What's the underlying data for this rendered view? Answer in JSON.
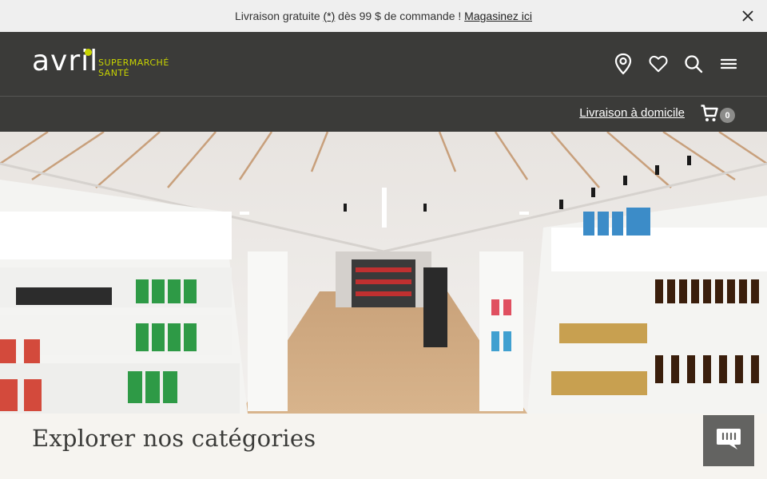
{
  "promo": {
    "text_before": "Livraison gratuite ",
    "asterisk_link": "(*)",
    "text_after": " dès 99 $ de commande ! ",
    "shop_link": "Magasinez ici"
  },
  "header": {
    "logo": {
      "word": "avril",
      "line1": "SUPERMARCHÉ",
      "line2": "SANTÉ"
    },
    "icons": [
      "location-icon",
      "heart-icon",
      "search-icon",
      "menu-icon"
    ]
  },
  "subheader": {
    "delivery_link": "Livraison à domicile",
    "cart_count": "0"
  },
  "main": {
    "section_title": "Explorer nos catégories"
  },
  "colors": {
    "header_bg": "#3b3b39",
    "accent": "#c8d400",
    "promo_bg": "#efefef",
    "page_bg": "#f6f4f0"
  }
}
